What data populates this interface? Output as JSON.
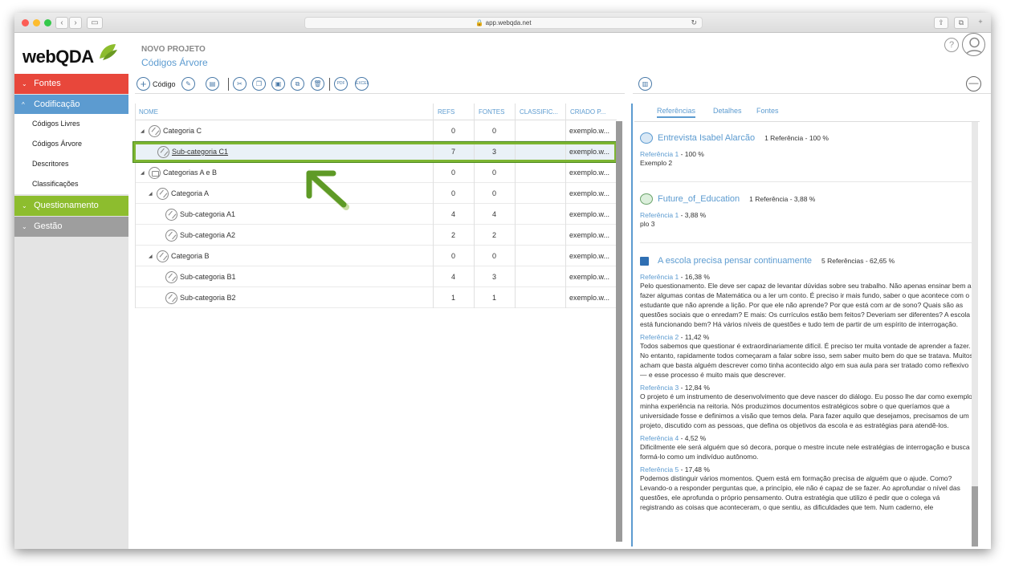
{
  "browser": {
    "url": "app.webqda.net"
  },
  "logo": {
    "text": "webQDA"
  },
  "sidebar": {
    "sections": [
      {
        "label": "Fontes",
        "color": "#e8473b",
        "chevron": "⌄"
      },
      {
        "label": "Codificação",
        "color": "#5c9bd0",
        "chevron": "^"
      },
      {
        "label": "Questionamento",
        "color": "#8dbd2e",
        "chevron": "⌄"
      },
      {
        "label": "Gestão",
        "color": "#9e9e9e",
        "chevron": "⌄"
      }
    ],
    "codificacao_items": [
      "Códigos Livres",
      "Códigos Árvore",
      "Descritores",
      "Classificações"
    ]
  },
  "header": {
    "project": "NOVO PROJETO",
    "breadcrumb": "Códigos Árvore"
  },
  "toolbar": {
    "add_label": "Código",
    "pdf_label": "PDF",
    "excel_label": "EXCEL"
  },
  "table": {
    "columns": [
      "NOME",
      "REFS",
      "FONTES",
      "CLASSIFIC...",
      "CRIADO P..."
    ],
    "rows": [
      {
        "name": "Categoria C",
        "refs": "0",
        "fontes": "0",
        "criado": "exemplo.w..."
      },
      {
        "name": "Sub-categoria C1",
        "refs": "7",
        "fontes": "3",
        "criado": "exemplo.w..."
      },
      {
        "name": "Categorias A e B",
        "refs": "0",
        "fontes": "0",
        "criado": "exemplo.w..."
      },
      {
        "name": "Categoria A",
        "refs": "0",
        "fontes": "0",
        "criado": "exemplo.w..."
      },
      {
        "name": "Sub-categoria A1",
        "refs": "4",
        "fontes": "4",
        "criado": "exemplo.w..."
      },
      {
        "name": "Sub-categoria A2",
        "refs": "2",
        "fontes": "2",
        "criado": "exemplo.w..."
      },
      {
        "name": "Categoria B",
        "refs": "0",
        "fontes": "0",
        "criado": "exemplo.w..."
      },
      {
        "name": "Sub-categoria B1",
        "refs": "4",
        "fontes": "3",
        "criado": "exemplo.w..."
      },
      {
        "name": "Sub-categoria B2",
        "refs": "1",
        "fontes": "1",
        "criado": "exemplo.w..."
      }
    ]
  },
  "tabs": [
    "Referências",
    "Detalhes",
    "Fontes"
  ],
  "sources": [
    {
      "title": "Entrevista Isabel Alarcão",
      "count": "1 Referência - 100 %",
      "refs": [
        {
          "label": "Referência 1",
          "pct": " - 100 %",
          "text": "Exemplo 2"
        }
      ]
    },
    {
      "title": "Future_of_Education",
      "count": "1 Referência - 3,88 %",
      "refs": [
        {
          "label": "Referência 1",
          "pct": " - 3,88 %",
          "text": "plo 3"
        }
      ]
    },
    {
      "title": "A escola precisa pensar continuamente",
      "count": "5 Referências - 62,65 %",
      "refs": [
        {
          "label": "Referência 1",
          "pct": " - 16,38 %",
          "text": "Pelo questionamento. Ele deve ser capaz de levantar dúvidas sobre seu trabalho. Não apenas ensinar bem a fazer algumas contas de Matemática ou a ler um conto. É preciso ir mais fundo, saber o que acontece com o estudante que não aprende a lição. Por que ele não aprende? Por que está com ar de sono? Quais são as questões sociais que o enredam? E mais: Os currículos estão bem feitos? Deveriam ser diferentes? A escola está funcionando bem? Há vários níveis de questões e tudo tem de partir de um espírito de interrogação."
        },
        {
          "label": "Referência 2",
          "pct": " - 11,42 %",
          "text": "Todos sabemos que questionar é extraordinariamente difícil. É preciso ter muita vontade de aprender a fazer. No entanto, rapidamente todos começaram a falar sobre isso, sem saber muito bem do que se tratava. Muitos acham que basta alguém descrever como tinha acontecido algo em sua aula para ser tratado como reflexivo — e esse processo é muito mais que descrever."
        },
        {
          "label": "Referência 3",
          "pct": " - 12,84 %",
          "text": "O projeto é um instrumento de desenvolvimento que deve nascer do diálogo. Eu posso lhe dar como exemplo minha experiência na reitoria. Nós produzimos documentos estratégicos sobre o que queríamos que a universidade fosse e definimos a visão que temos dela. Para fazer aquilo que desejamos, precisamos de um projeto, discutido com as pessoas, que defina os objetivos da escola e as estratégias para atendê-los."
        },
        {
          "label": "Referência 4",
          "pct": " - 4,52 %",
          "text": "Dificilmente ele será alguém que só decora, porque o mestre incute nele estratégias de interrogação e busca formá-lo como um indivíduo autônomo."
        },
        {
          "label": "Referência 5",
          "pct": " - 17,48 %",
          "text": "Podemos distinguir vários momentos. Quem está em formação precisa de alguém que o ajude. Como? Levando-o a responder perguntas que, a princípio, ele não é capaz de se fazer. Ao aprofundar o nível das questões, ele aprofunda o próprio pensamento. Outra estratégia que utilizo é pedir que o colega vá registrando as coisas que aconteceram, o que sentiu, as dificuldades que tem. Num caderno, ele"
        }
      ]
    }
  ]
}
